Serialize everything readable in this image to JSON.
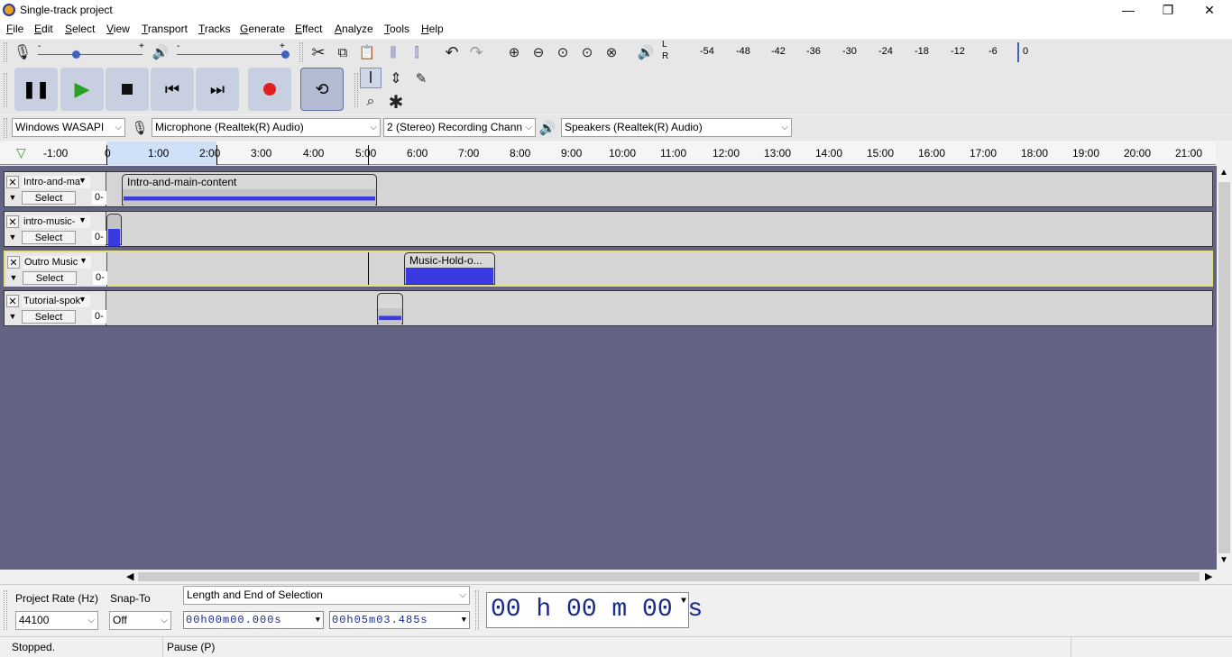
{
  "window": {
    "title": "Single-track project",
    "minimize": "—",
    "maximize": "❐",
    "close": "✕"
  },
  "menu": [
    "File",
    "Edit",
    "Select",
    "View",
    "Transport",
    "Tracks",
    "Generate",
    "Effect",
    "Analyze",
    "Tools",
    "Help"
  ],
  "meter": {
    "l": "L",
    "r": "R",
    "ticks": [
      "-54",
      "-48",
      "-42",
      "-36",
      "-30",
      "-24",
      "-18",
      "-12",
      "-6",
      "0"
    ],
    "mic_minus": "-",
    "mic_plus": "+",
    "spk_minus": "-",
    "spk_plus": "+"
  },
  "devices": {
    "host": "Windows WASAPI",
    "mic": "Microphone (Realtek(R) Audio)",
    "channels": "2 (Stereo) Recording Chann",
    "speaker": "Speakers (Realtek(R) Audio)"
  },
  "ruler": {
    "ticks": [
      "-1:00",
      "0",
      "1:00",
      "2:00",
      "3:00",
      "4:00",
      "5:00",
      "6:00",
      "7:00",
      "8:00",
      "9:00",
      "10:00",
      "11:00",
      "12:00",
      "13:00",
      "14:00",
      "15:00",
      "16:00",
      "17:00",
      "18:00",
      "19:00",
      "20:00",
      "21:00"
    ]
  },
  "tracks": [
    {
      "name": "Intro-and-ma",
      "select": "Select",
      "zero": "0-",
      "clip": "Intro-and-main-content"
    },
    {
      "name": "intro-music-",
      "select": "Select",
      "zero": "0-",
      "clip": ""
    },
    {
      "name": "Outro Music",
      "select": "Select",
      "zero": "0-",
      "clip": "Music-Hold-o..."
    },
    {
      "name": "Tutorial-spok",
      "select": "Select",
      "zero": "0-",
      "clip": ""
    }
  ],
  "selection": {
    "rate_label": "Project Rate (Hz)",
    "rate_value": "44100",
    "snap_label": "Snap-To",
    "snap_value": "Off",
    "mode": "Length and End of Selection",
    "start": "00h00m00.000s",
    "end": "00h05m03.485s",
    "audio_pos": "00 h 00 m 00 s"
  },
  "status": {
    "left": "Stopped.",
    "middle": "Pause (P)"
  }
}
